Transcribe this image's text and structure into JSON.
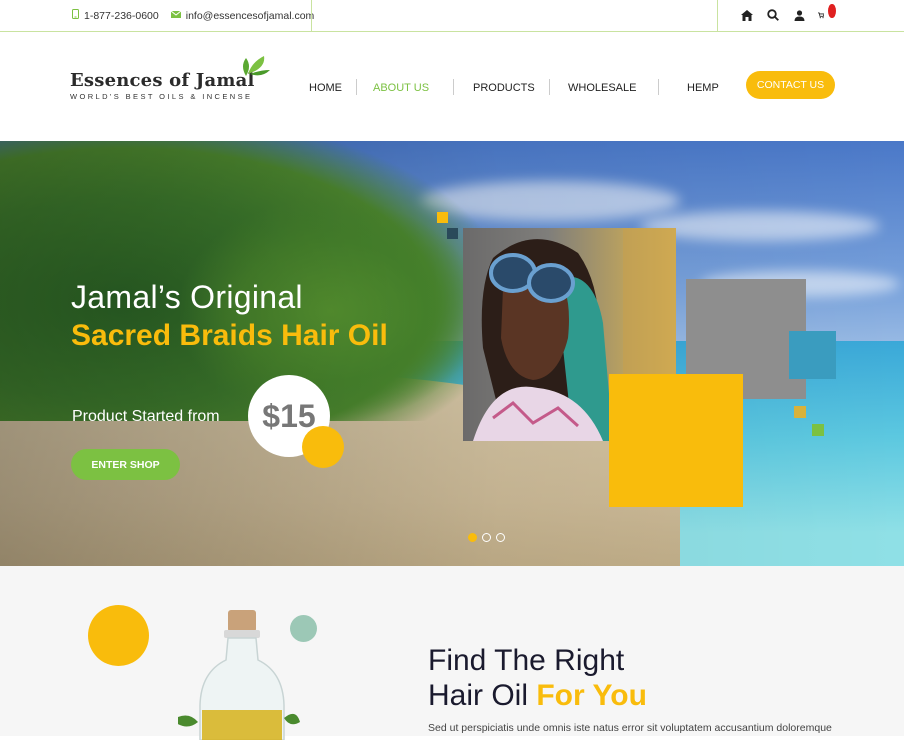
{
  "topbar": {
    "phone": "1-877-236-0600",
    "email": "info@essencesofjamal.com",
    "icons": [
      "home-icon",
      "search-icon",
      "user-icon",
      "cart-icon"
    ],
    "cart_count": "0"
  },
  "header": {
    "logo_title": "Essences of Jamal",
    "logo_subtitle": "WORLD'S BEST OILS & INCENSE",
    "nav": [
      "HOME",
      "ABOUT US",
      "PRODUCTS",
      "WHOLESALE",
      "HEMP"
    ],
    "active_nav": "ABOUT US",
    "contact_button": "CONTACT US"
  },
  "hero": {
    "title_line1": "Jamal’s Original",
    "title_line2": "Sacred Braids Hair Oil",
    "price_label": "Product Started from",
    "price": "$15",
    "cta": "ENTER SHOP",
    "slides": 3,
    "active_slide": 1
  },
  "section": {
    "title_line1": "Find The Right",
    "title_line2_plain": "Hair Oil",
    "title_line2_highlight": "For You",
    "body": "Sed ut perspiciatis unde omnis iste natus error sit voluptatem accusantium doloremque"
  },
  "colors": {
    "accent_green": "#7cc142",
    "accent_yellow": "#f9bc0c",
    "teal": "#3a9cbf",
    "dark_text": "#1a1a2e"
  }
}
